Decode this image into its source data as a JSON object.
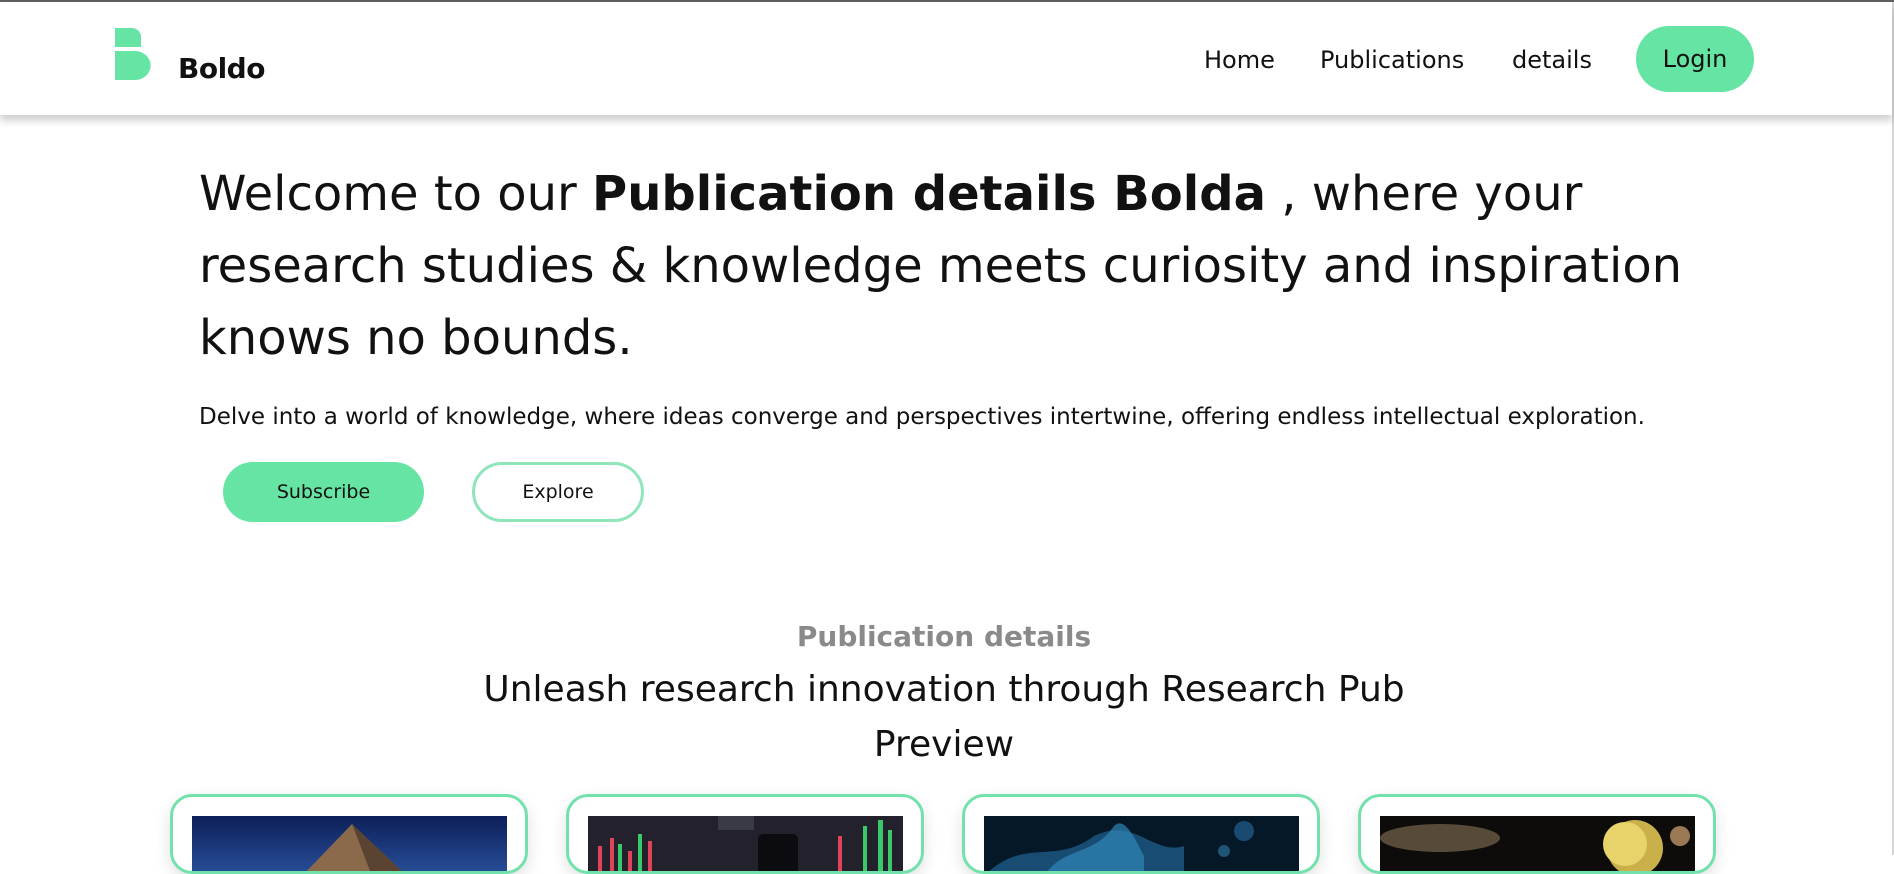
{
  "brand": {
    "name": "Boldo",
    "accent_color": "#65e4a3"
  },
  "nav": {
    "items": [
      {
        "label": "Home"
      },
      {
        "label": "Publications"
      },
      {
        "label": "details"
      }
    ],
    "login_label": "Login"
  },
  "hero": {
    "title_prefix": "Welcome to our ",
    "title_bold": "Publication details Bolda",
    "title_suffix": " , where your research studies & knowledge meets curiosity and inspiration knows no bounds.",
    "subtitle": "Delve into a world of knowledge, where ideas converge and perspectives intertwine, offering endless intellectual exploration.",
    "subscribe_label": "Subscribe",
    "explore_label": "Explore"
  },
  "section": {
    "eyebrow": "Publication details",
    "title": "Unleash research innovation through Research Pub Preview"
  },
  "cards": [
    {
      "image": "pyramid-night-photo"
    },
    {
      "image": "stock-chart-photo"
    },
    {
      "image": "blue-smoke-photo"
    },
    {
      "image": "planets-space-photo"
    }
  ]
}
